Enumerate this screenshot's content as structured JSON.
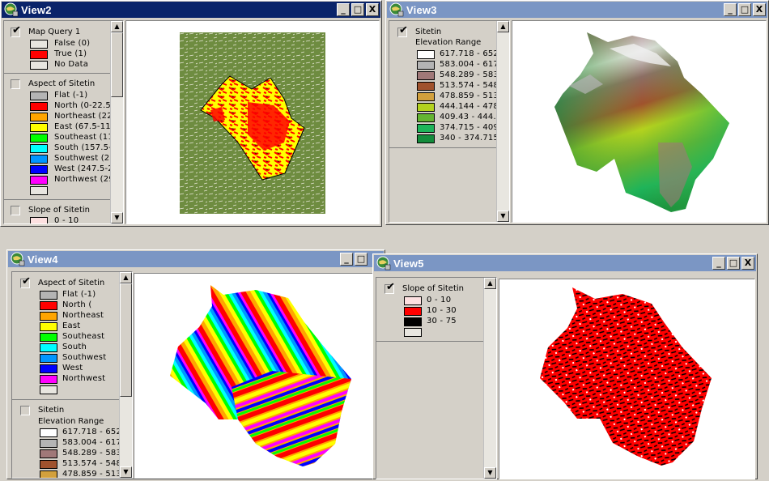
{
  "windows": {
    "view2": {
      "title": "View2",
      "state": "active",
      "buttons": [
        "_",
        "□",
        "X"
      ],
      "themes": [
        {
          "name": "Map Query 1",
          "checked": true,
          "items": [
            {
              "label": "False (0)",
              "color": "#e8e6e0"
            },
            {
              "label": "True (1)",
              "color": "#ff0000"
            },
            {
              "label": "No Data",
              "color": "#e8e6e0"
            }
          ]
        },
        {
          "name": "Aspect of Sitetin",
          "checked": false,
          "items": [
            {
              "label": "Flat (-1)",
              "color": "#b4b4b4"
            },
            {
              "label": "North (0-22.5",
              "color": "#ff0000"
            },
            {
              "label": "Northeast (22",
              "color": "#ffa500"
            },
            {
              "label": "East (67.5-11",
              "color": "#ffff00"
            },
            {
              "label": "Southeast (11",
              "color": "#00ff00"
            },
            {
              "label": "South (157.5-",
              "color": "#00ffff"
            },
            {
              "label": "Southwest (20",
              "color": "#0096ff"
            },
            {
              "label": "West (247.5-2",
              "color": "#0000ff"
            },
            {
              "label": "Northwest (29",
              "color": "#ff00ff"
            },
            {
              "label": "",
              "color": "#e8e6e0"
            }
          ]
        },
        {
          "name": "Slope of Sitetin",
          "checked": false,
          "items": [
            {
              "label": "0 - 10",
              "color": "#fde0e0"
            }
          ]
        }
      ]
    },
    "view3": {
      "title": "View3",
      "state": "inactive",
      "buttons": [
        "_",
        "□",
        "X"
      ],
      "theme": {
        "name": "Sitetin",
        "checked": true,
        "subtitle": "Elevation Range",
        "items": [
          {
            "label": "617.718 - 652",
            "color": "#ffffff"
          },
          {
            "label": "583.004 - 617",
            "color": "#b4b4b4"
          },
          {
            "label": "548.289 - 583",
            "color": "#a07878"
          },
          {
            "label": "513.574 - 548",
            "color": "#a0522d"
          },
          {
            "label": "478.859 - 513",
            "color": "#d2a03c"
          },
          {
            "label": "444.144 - 478",
            "color": "#b4d21e"
          },
          {
            "label": "409.43 - 444.",
            "color": "#64b432"
          },
          {
            "label": "374.715 - 409",
            "color": "#1eb45a"
          },
          {
            "label": "340 - 374.715",
            "color": "#148c3c"
          }
        ]
      }
    },
    "view4": {
      "title": "View4",
      "state": "inactive",
      "buttons": [
        "_",
        "□"
      ],
      "themes": [
        {
          "name": "Aspect of Sitetin",
          "checked": true,
          "items": [
            {
              "label": "Flat (-1)",
              "color": "#b4b4b4"
            },
            {
              "label": "North (",
              "color": "#ff0000"
            },
            {
              "label": "Northeast",
              "color": "#ffa500"
            },
            {
              "label": "East",
              "color": "#ffff00"
            },
            {
              "label": "Southeast",
              "color": "#00ff00"
            },
            {
              "label": "South",
              "color": "#00ffff"
            },
            {
              "label": "Southwest",
              "color": "#0096ff"
            },
            {
              "label": "West",
              "color": "#0000ff"
            },
            {
              "label": "Northwest",
              "color": "#ff00ff"
            },
            {
              "label": "",
              "color": "#e8e6e0"
            }
          ]
        },
        {
          "name": "Sitetin",
          "checked": false,
          "subtitle": "Elevation Range",
          "items": [
            {
              "label": "617.718 - 652",
              "color": "#ffffff"
            },
            {
              "label": "583.004 - 617",
              "color": "#b4b4b4"
            },
            {
              "label": "548.289 - 583",
              "color": "#a07878"
            },
            {
              "label": "513.574 - 548",
              "color": "#a0522d"
            },
            {
              "label": "478.859 - 513",
              "color": "#d2a03c"
            }
          ]
        }
      ]
    },
    "view5": {
      "title": "View5",
      "state": "inactive",
      "buttons": [
        "_",
        "□",
        "X"
      ],
      "theme": {
        "name": "Slope of Sitetin",
        "checked": true,
        "items": [
          {
            "label": "0 - 10",
            "color": "#fde0e0"
          },
          {
            "label": "10 - 30",
            "color": "#ff0000"
          },
          {
            "label": "30 - 75",
            "color": "#000000"
          },
          {
            "label": "",
            "color": "#e8e6e0"
          }
        ]
      }
    }
  },
  "map_colors": {
    "vegetation": "#6e8c40",
    "query_fill": "#ffff00",
    "query_true": "#ff0000"
  }
}
